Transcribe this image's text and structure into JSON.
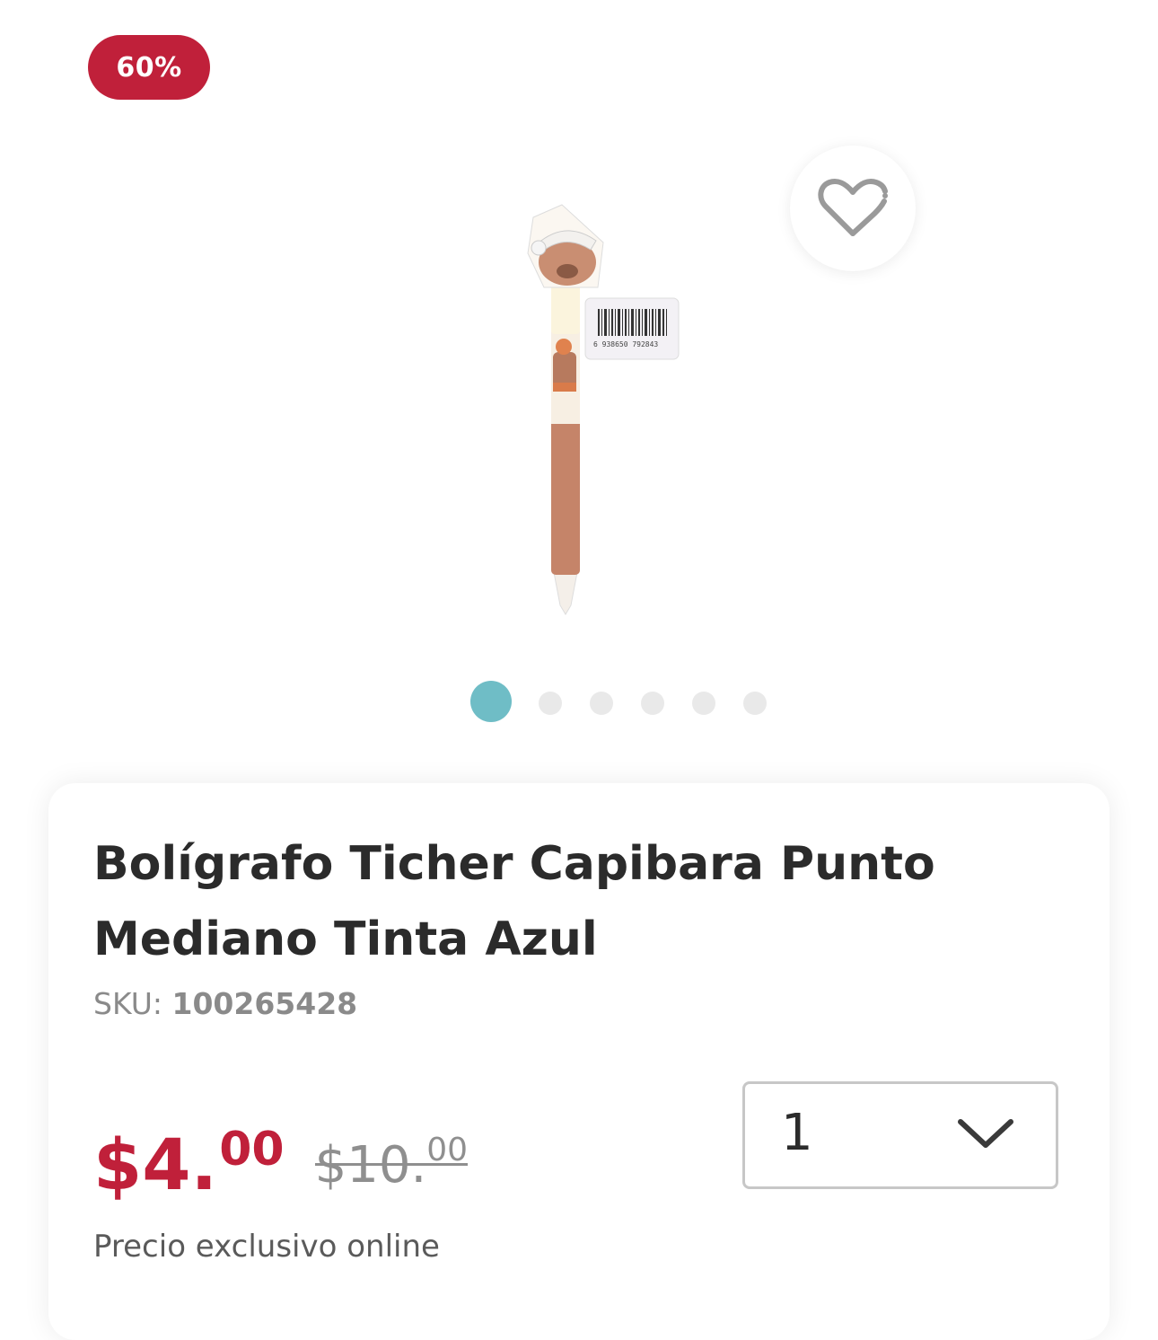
{
  "badge": {
    "discount": "60%"
  },
  "product": {
    "image_icon": "capybara-pen-image",
    "barcode_text": "6 938650 792843",
    "title": "Bolígrafo Ticher Capibara Punto Mediano Tinta Azul",
    "sku_label": "SKU:",
    "sku_value": "100265428"
  },
  "gallery": {
    "total_images": 6,
    "active_index": 0
  },
  "price": {
    "current_main": "$4.",
    "current_cents": "00",
    "old_main": "$10.",
    "old_cents": "00",
    "note": "Precio exclusivo online"
  },
  "quantity": {
    "selected": "1"
  },
  "colors": {
    "accent_red": "#c0203a",
    "dot_active": "#6fbdc6",
    "dot_inactive": "#e9e9e9"
  }
}
